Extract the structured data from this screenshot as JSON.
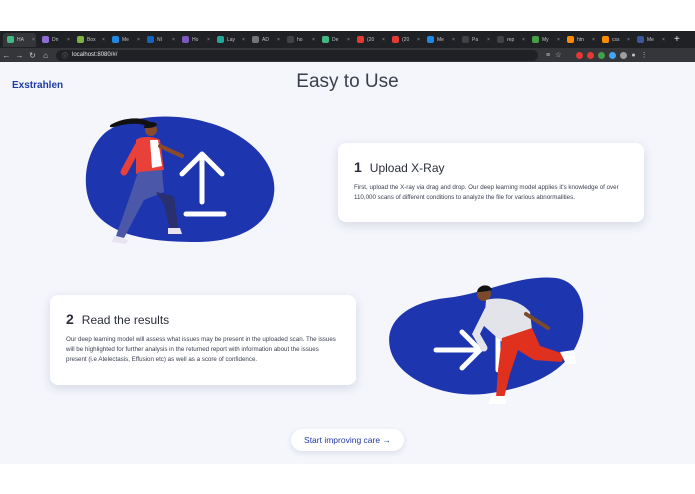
{
  "browser": {
    "tabs": [
      {
        "label": "HA",
        "color": "#42b883",
        "active": true
      },
      {
        "label": "Dn",
        "color": "#8e6bd8"
      },
      {
        "label": "Box",
        "color": "#7cb342"
      },
      {
        "label": "Me",
        "color": "#1e88e5"
      },
      {
        "label": "NI",
        "color": "#1565c0"
      },
      {
        "label": "Ho",
        "color": "#7e57c2"
      },
      {
        "label": "Lay",
        "color": "#26a69a"
      },
      {
        "label": "AD",
        "color": "#757575"
      },
      {
        "label": "ho",
        "color": "#424242"
      },
      {
        "label": "De",
        "color": "#42b883"
      },
      {
        "label": "(20",
        "color": "#e53935"
      },
      {
        "label": "(20",
        "color": "#e53935"
      },
      {
        "label": "Me",
        "color": "#1e88e5"
      },
      {
        "label": "Pa",
        "color": "#424242"
      },
      {
        "label": "rep",
        "color": "#424242"
      },
      {
        "label": "My",
        "color": "#43a047"
      },
      {
        "label": "htn",
        "color": "#fb8c00"
      },
      {
        "label": "css",
        "color": "#fb8c00"
      },
      {
        "label": "Me",
        "color": "#3b5998"
      }
    ],
    "new_tab": "+",
    "url": "localhost:8080/#/",
    "extension_colors": [
      "#e53935",
      "#e53935",
      "#43a047",
      "#42a5f5",
      "#9e9e9e"
    ]
  },
  "page": {
    "brand": "Exstrahlen",
    "title": "Easy to Use",
    "step1": {
      "number": "1",
      "heading": "Upload X-Ray",
      "body": "First, upload the X-ray via drag and drop. Our deep learning model applies it's knowledge of over 110,000 scans of different conditions to analyze the file for various abnormalities."
    },
    "step2": {
      "number": "2",
      "heading": "Read the results",
      "body": "Our deep learning model will assess what issues may be present in the uploaded scan. The issues will be highlighted for further analysis in the returned report with information about the issues present (i.e Atelectasis, Effusion etc) as well as a score of confidence."
    },
    "cta": "Start improving care →"
  },
  "colors": {
    "blob": "#1e35b0",
    "accent": "#1f3aa3",
    "shirt_red": "#e9403a",
    "trouser_red": "#e0311f"
  }
}
